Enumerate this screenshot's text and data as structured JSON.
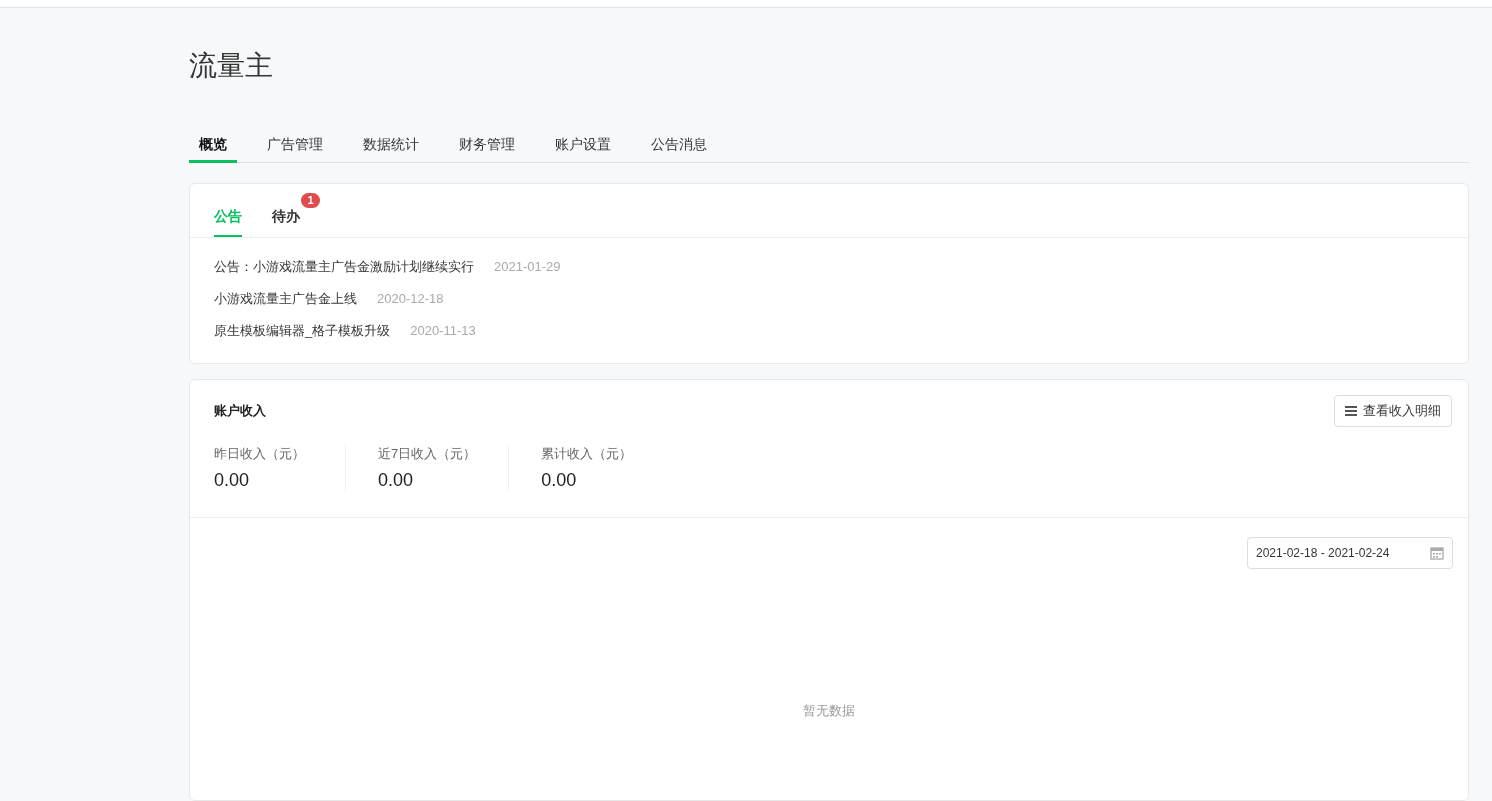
{
  "page_title": "流量主",
  "tabs": [
    {
      "label": "概览",
      "selected": true
    },
    {
      "label": "广告管理",
      "selected": false
    },
    {
      "label": "数据统计",
      "selected": false
    },
    {
      "label": "财务管理",
      "selected": false
    },
    {
      "label": "账户设置",
      "selected": false
    },
    {
      "label": "公告消息",
      "selected": false
    }
  ],
  "notice_card": {
    "tabs": [
      {
        "label": "公告",
        "selected": true
      },
      {
        "label": "待办",
        "selected": false,
        "badge": "1"
      }
    ],
    "items": [
      {
        "title": "公告：小游戏流量主广告金激励计划继续实行",
        "date": "2021-01-29"
      },
      {
        "title": "小游戏流量主广告金上线",
        "date": "2020-12-18"
      },
      {
        "title": "原生模板编辑器_格子模板升级",
        "date": "2020-11-13"
      }
    ]
  },
  "income_card": {
    "title": "账户收入",
    "detail_button": "查看收入明细",
    "stats": [
      {
        "label": "昨日收入（元）",
        "value": "0.00"
      },
      {
        "label": "近7日收入（元）",
        "value": "0.00"
      },
      {
        "label": "累计收入（元）",
        "value": "0.00"
      }
    ],
    "date_range": "2021-02-18 - 2021-02-24",
    "empty_text": "暂无数据"
  }
}
